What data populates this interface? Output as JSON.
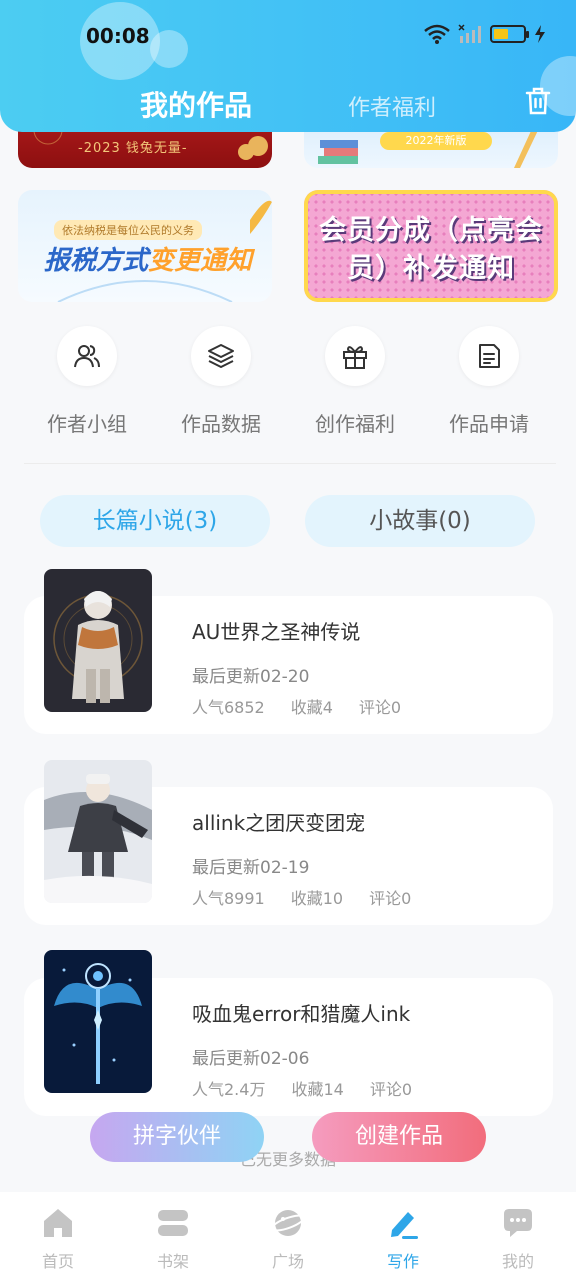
{
  "status_bar": {
    "time": "00:08"
  },
  "header": {
    "tabs": [
      {
        "label": "我的作品",
        "active": true
      },
      {
        "label": "作者福利",
        "active": false
      }
    ]
  },
  "banners": [
    {
      "text": "-2023 钱兔无量-"
    },
    {
      "text": "2022年新版"
    },
    {
      "small": "依法纳税是每位公民的义务",
      "title_part1": "报税方式",
      "title_part2": "变更通知"
    },
    {
      "line1": "会员分成（点亮会",
      "line2": "员）补发通知"
    }
  ],
  "quick_actions": [
    {
      "label": "作者小组",
      "icon": "users-icon"
    },
    {
      "label": "作品数据",
      "icon": "layers-icon"
    },
    {
      "label": "创作福利",
      "icon": "gift-icon"
    },
    {
      "label": "作品申请",
      "icon": "document-icon"
    }
  ],
  "segments": [
    {
      "label": "长篇小说(3)",
      "active": true
    },
    {
      "label": "小故事(0)",
      "active": false
    }
  ],
  "works": [
    {
      "title": "AU世界之圣神传说",
      "updated": "最后更新02-20",
      "popularity": "人气6852",
      "favorites": "收藏4",
      "comments": "评论0"
    },
    {
      "title": "allink之团厌变团宠",
      "updated": "最后更新02-19",
      "popularity": "人气8991",
      "favorites": "收藏10",
      "comments": "评论0"
    },
    {
      "title": "吸血鬼error和猎魔人ink",
      "updated": "最后更新02-06",
      "popularity": "人气2.4万",
      "favorites": "收藏14",
      "comments": "评论0"
    }
  ],
  "no_more_text": "已无更多数据",
  "floating_buttons": {
    "partner": "拼字伙伴",
    "create": "创建作品"
  },
  "bottom_nav": [
    {
      "label": "首页",
      "icon": "home-icon",
      "active": false
    },
    {
      "label": "书架",
      "icon": "bookshelf-icon",
      "active": false
    },
    {
      "label": "广场",
      "icon": "planet-icon",
      "active": false
    },
    {
      "label": "写作",
      "icon": "pen-icon",
      "active": true
    },
    {
      "label": "我的",
      "icon": "chat-icon",
      "active": false
    }
  ],
  "colors": {
    "accent": "#2ea6e8",
    "header": "#43c2f5",
    "inactive": "#bbbbbb"
  }
}
